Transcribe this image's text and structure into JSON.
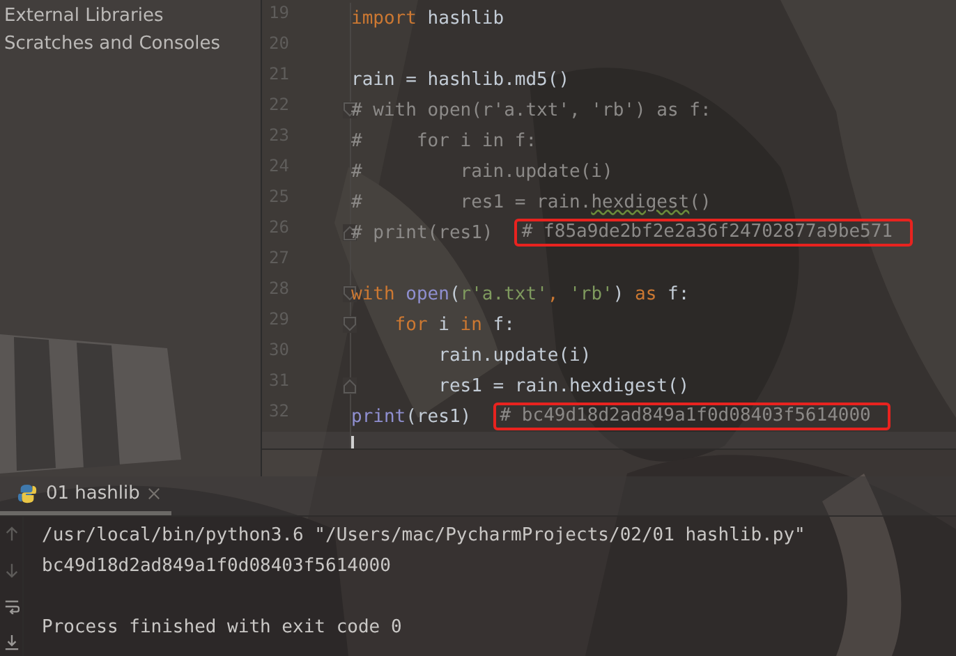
{
  "project_panel": {
    "items": [
      {
        "label": "External Libraries"
      },
      {
        "label": "Scratches and Consoles"
      }
    ]
  },
  "editor": {
    "lines": [
      {
        "number": "19",
        "fold_start": false,
        "fold_end": false,
        "tokens": [
          {
            "kind": "keyword",
            "text": "import"
          },
          {
            "kind": "plain",
            "text": " hashlib"
          }
        ]
      },
      {
        "number": "20",
        "fold_start": false,
        "fold_end": false
      },
      {
        "number": "21",
        "fold_start": false,
        "fold_end": false,
        "tokens": [
          {
            "kind": "plain",
            "text": "rain = hashlib.md5()"
          }
        ]
      },
      {
        "number": "22",
        "fold_start": true,
        "fold_end": false,
        "tokens": [
          {
            "kind": "comment",
            "text": "# with open(r'a.txt', 'rb') as f:"
          }
        ]
      },
      {
        "number": "23",
        "fold_start": false,
        "fold_end": false,
        "tokens": [
          {
            "kind": "comment",
            "text": "#     for i in f:"
          }
        ]
      },
      {
        "number": "24",
        "fold_start": false,
        "fold_end": false,
        "tokens": [
          {
            "kind": "comment",
            "text": "#         rain.update(i)"
          }
        ]
      },
      {
        "number": "25",
        "fold_start": false,
        "fold_end": false,
        "tokens": [
          {
            "kind": "comment",
            "text": "#         res1 = rain."
          },
          {
            "kind": "misspelled",
            "text": "hexdigest"
          },
          {
            "kind": "comment",
            "text": "()"
          }
        ]
      },
      {
        "number": "26",
        "fold_start": false,
        "fold_end": true,
        "tokens": [
          {
            "kind": "comment",
            "text": "# print(res1)  "
          },
          {
            "kind": "boxed",
            "text": "# f85a9de2bf2e2a36f24702877a9be571"
          }
        ]
      },
      {
        "number": "27",
        "fold_start": false,
        "fold_end": false
      },
      {
        "number": "28",
        "fold_start": true,
        "fold_end": false,
        "tokens": [
          {
            "kind": "keyword",
            "text": "with "
          },
          {
            "kind": "builtin",
            "text": "open"
          },
          {
            "kind": "plain",
            "text": "("
          },
          {
            "kind": "string",
            "text": "r'a.txt'"
          },
          {
            "kind": "keyword",
            "text": ", "
          },
          {
            "kind": "string",
            "text": "'rb'"
          },
          {
            "kind": "plain",
            "text": ") "
          },
          {
            "kind": "keyword",
            "text": "as"
          },
          {
            "kind": "plain",
            "text": " f:"
          }
        ]
      },
      {
        "number": "29",
        "fold_start": true,
        "fold_end": false,
        "tokens": [
          {
            "kind": "keyword",
            "text": "    for"
          },
          {
            "kind": "plain",
            "text": " i "
          },
          {
            "kind": "keyword",
            "text": "in"
          },
          {
            "kind": "plain",
            "text": " f:"
          }
        ]
      },
      {
        "number": "30",
        "fold_start": false,
        "fold_end": false,
        "tokens": [
          {
            "kind": "plain",
            "text": "        rain.update(i)"
          }
        ]
      },
      {
        "number": "31",
        "fold_start": false,
        "fold_end": true,
        "tokens": [
          {
            "kind": "plain",
            "text": "        res1 = rain.hexdigest()"
          }
        ]
      },
      {
        "number": "32",
        "fold_start": false,
        "fold_end": false,
        "tokens": [
          {
            "kind": "builtin",
            "text": "print"
          },
          {
            "kind": "plain",
            "text": "(res1)  "
          },
          {
            "kind": "boxed",
            "text": "# bc49d18d2ad849a1f0d08403f5614000"
          }
        ]
      },
      {
        "current": true,
        "fold_start": false,
        "fold_end": false
      }
    ]
  },
  "run_panel": {
    "tabs": [
      {
        "label": "01 hashlib",
        "selected": true
      }
    ],
    "output_blocks": [
      {
        "lines": [
          "/usr/local/bin/python3.6 \"/Users/mac/PycharmProjects/02/01 hashlib.py\"",
          "bc49d18d2ad849a1f0d08403f5614000"
        ]
      },
      {
        "lines": [
          "Process finished with exit code 0"
        ]
      }
    ]
  }
}
